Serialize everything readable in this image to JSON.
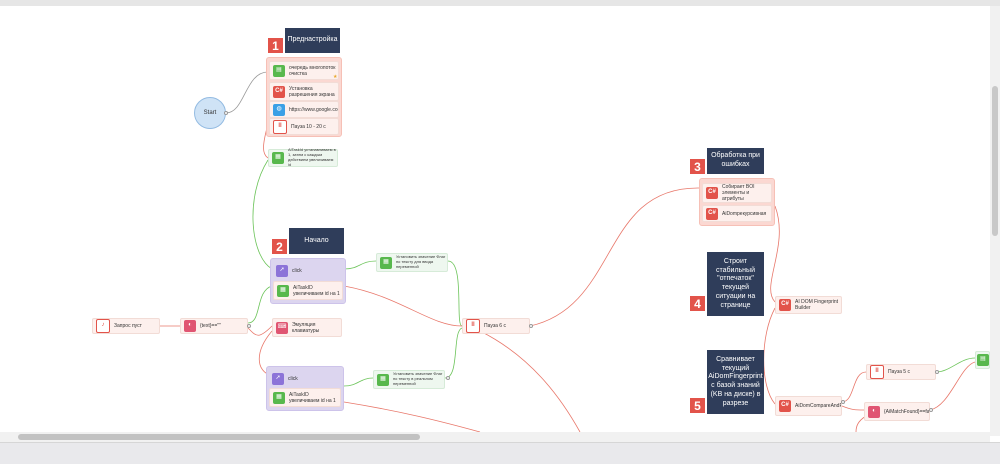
{
  "start": {
    "label": "Start"
  },
  "sections": [
    {
      "number": "1",
      "title": "Преднастройка"
    },
    {
      "number": "2",
      "title": "Начало"
    },
    {
      "number": "3",
      "title": "Обработка при ошибках"
    },
    {
      "number": "4",
      "title": "Строит стабильный \"отпечаток\" текущей ситуации на странице"
    },
    {
      "number": "5",
      "title": "Сравнивает текущий AiDomFingerprint с базой знаний (KB на диске) в разрезе"
    }
  ],
  "nodes": {
    "queue_clear": "очередь многопоток очистка",
    "set_resolution": "Установка разрешения экрана",
    "url": "https://www.google.com/",
    "pause_10_20": "Пауза 10 - 20 с",
    "ai_task_set": "AiTaskId устанавливаем в 1, затем с каждым действием увеличиваем id",
    "click1": "click",
    "ai_task_inc1": "AiTaskID увеличиваем id на 1",
    "set_flag1": "Установить значение Флаг по тексту для ввода переменной",
    "pause_6": "Пауза 6 с",
    "query_empty": "Запрос пуст",
    "text_condition": "{text}==\"\"",
    "keyboard_emulation": "Эмуляция клавиатуры",
    "click2": "click",
    "ai_task_inc2": "AiTaskID увеличиваем id на 1",
    "set_flag2": "Установить значение Флаг по тексту в реальном переменной",
    "collect_elements": "Собирает BOI элементы и атрибуты",
    "ai_dom_recursive": "AiDomрекурсивная",
    "ai_dom_fingerprint": "AI DOM Fingerprint Builder",
    "ai_dom_compare": "AiDomCompareAndPatch",
    "pause_5": "Пауза 5 с",
    "ai_match_found": "{AiMatchFound}==false"
  },
  "icons": {
    "doc": "document-icon",
    "csharp": "csharp-icon",
    "globe": "globe-icon",
    "pause": "pause-icon",
    "grid": "grid-icon",
    "cursor": "cursor-icon",
    "bell": "bell-icon",
    "toggle": "toggle-icon",
    "keyboard": "keyboard-icon"
  },
  "colors": {
    "title_bg": "#2f3d5a",
    "number_bg": "#e2534a",
    "link_red": "#e8776a",
    "link_green": "#6cc45a",
    "link_gray": "#9a9a9a"
  }
}
